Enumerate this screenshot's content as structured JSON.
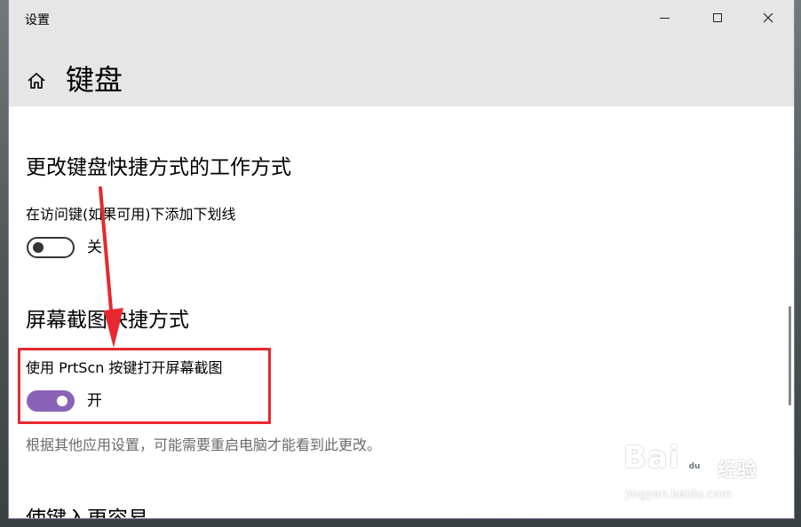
{
  "window": {
    "app_title": "设置",
    "page_title": "键盘"
  },
  "sections": {
    "keyboard_shortcuts": {
      "heading": "更改键盘快捷方式的工作方式",
      "setting_label": "在访问键(如果可用)下添加下划线",
      "toggle_state": "关",
      "toggle_on": false
    },
    "screenshot_shortcut": {
      "heading": "屏幕截图快捷方式",
      "setting_label": "使用 PrtScn 按键打开屏幕截图",
      "toggle_state": "开",
      "toggle_on": true,
      "hint": "根据其他应用设置，可能需要重启电脑才能看到此更改。"
    },
    "next_section_heading_partial": "使键入更容易"
  },
  "watermark": {
    "brand": "Bai",
    "brand_suffix": "du",
    "brand_cn": "经验",
    "url": "jingyan.baidu.com"
  },
  "colors": {
    "accent": "#8a63b7",
    "highlight_border": "#e8282e",
    "arrow": "#e8282e",
    "titlebar_bg": "#e6e6e6"
  },
  "icons": {
    "home": "home-icon",
    "minimize": "minimize-icon",
    "maximize": "maximize-icon",
    "close": "close-icon"
  }
}
